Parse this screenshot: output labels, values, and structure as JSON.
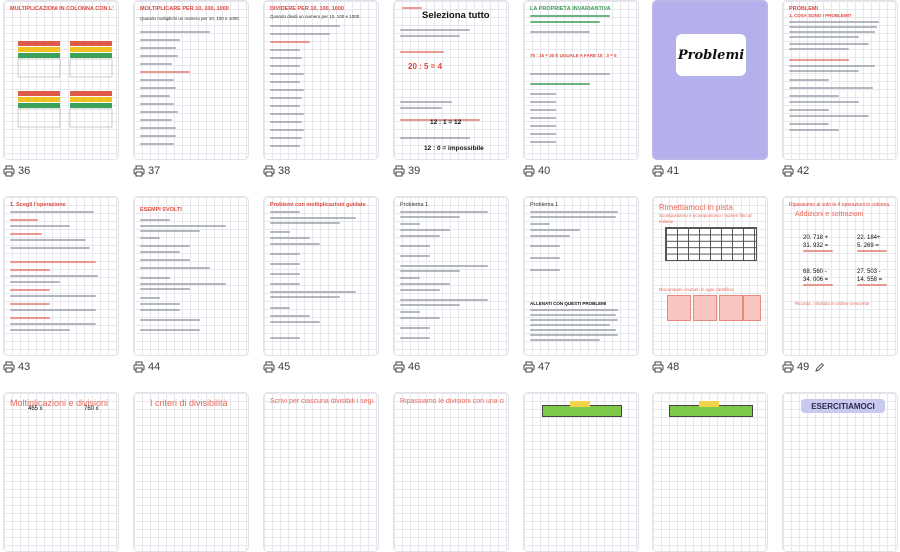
{
  "thumbnails": [
    {
      "num": "36",
      "title": "MULTIPLICAZIONI IN COLONNA CON L'AIUTO DELLA TABELLA"
    },
    {
      "num": "37",
      "title": "MOLTIPLICARE PER 10, 100, 1000",
      "text1": "Quando moltiplichi un numero per 10, 100 e 1000"
    },
    {
      "num": "38",
      "title": "DIVIDERE PER 10, 100, 1000",
      "text1": "Quando dividi un numero per 10, 100 e 1000"
    },
    {
      "num": "39",
      "title": "Seleziona tutto",
      "text1": "12 : 1 = 12",
      "text2": "12 : 0 = impossibile",
      "text3": "20 : 5 = 4"
    },
    {
      "num": "40",
      "title": "LA PROPRIETÀ INVARIANTIVA",
      "text1": "75 : 15 = 30 È UGUALE A FARE 15 : 3 = 5"
    },
    {
      "num": "41",
      "card": "Problemi"
    },
    {
      "num": "42",
      "title": "PROBLEMI",
      "text1": "1. COSA SONO I PROBLEMI?"
    },
    {
      "num": "43",
      "title": "1. Scegli l'operazione"
    },
    {
      "num": "44",
      "title": "ESEMPI SVOLTI"
    },
    {
      "num": "45",
      "title": "Problemi con moltiplicazioni guidate"
    },
    {
      "num": "46",
      "title": "Problema 1"
    },
    {
      "num": "47",
      "title": "Problema 1",
      "text1": "ALLENATI CON QUESTI PROBLEMI"
    },
    {
      "num": "48",
      "title": "Rimettiamoci in pista",
      "text1": "Scomponiamo e ricomponiamo i numeri fino al milione",
      "text2": "Riscomponi i numeri in ogni cartellino"
    },
    {
      "num": "49",
      "title": "Ripassiamo al volo le 4 operazioni in colonna",
      "text1": "Addizioni e sottrazioni",
      "n1": "20. 718 +",
      "n2": "31. 932 =",
      "n3": "22. 184+",
      "n4": "5. 269 =",
      "n5": "68. 560 -",
      "n6": "34. 006 =",
      "n7": "27. 503 -",
      "n8": "14. 558 =",
      "text2": "Ricorda : risultato in ordine crescente"
    },
    {
      "title": "Moltiplicazioni e divisioni",
      "n1": "465 x",
      "n2": "760 x"
    },
    {
      "title": "I criteri di divisibilità"
    },
    {
      "title": "Scrivi per ciascuna divisibili i seguenti numeri"
    },
    {
      "title": "Ripassiamo le divisioni con una cifra al divisore"
    },
    {},
    {
      "title": "ESERCITIAMOCI"
    }
  ],
  "colors": {
    "accent_red": "#e0473a",
    "selected_border": "#b9b6ea",
    "lavender": "#b4b0ec"
  }
}
